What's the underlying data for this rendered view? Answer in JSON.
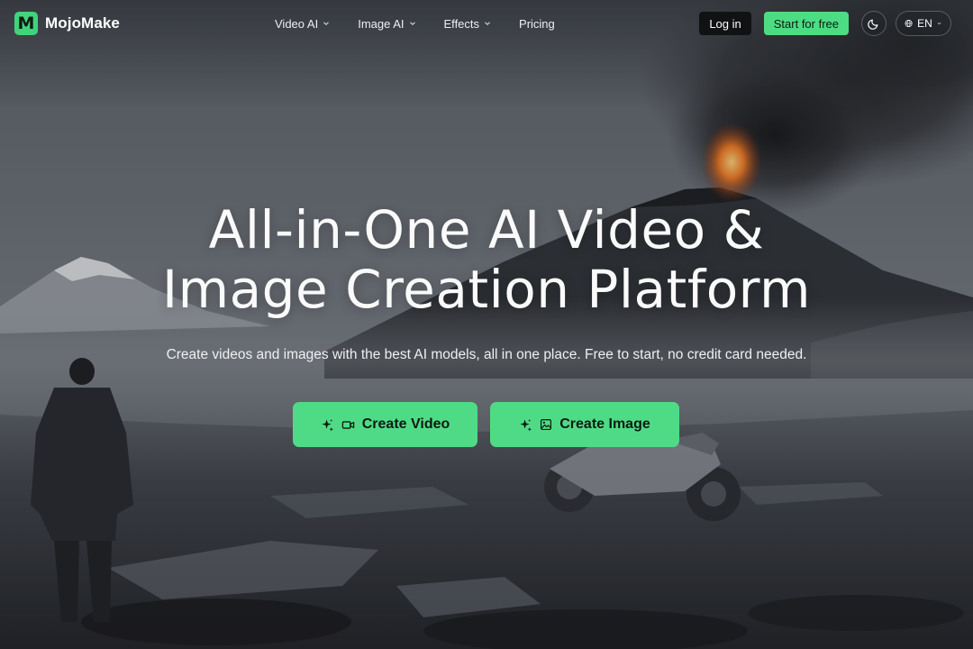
{
  "brand": {
    "mark": "M",
    "name": "MojoMake"
  },
  "nav": [
    {
      "label": "Video AI",
      "has_dropdown": true
    },
    {
      "label": "Image AI",
      "has_dropdown": true
    },
    {
      "label": "Effects",
      "has_dropdown": true
    },
    {
      "label": "Pricing",
      "has_dropdown": false
    }
  ],
  "actions": {
    "login_label": "Log in",
    "start_label": "Start for free",
    "theme_icon": "moon-icon",
    "language_label": "EN",
    "language_icon": "globe-icon"
  },
  "hero": {
    "title_line1": "All-in-One AI Video &",
    "title_line2": "Image Creation Platform",
    "subtitle": "Create videos and images with the best AI models, all in one place. Free to start, no credit card needed."
  },
  "cta": {
    "video_label": "Create Video",
    "video_icons": [
      "sparkle-icon",
      "video-camera-icon"
    ],
    "image_label": "Create Image",
    "image_icons": [
      "sparkle-icon",
      "image-icon"
    ]
  },
  "colors": {
    "accent": "#4fdb86",
    "login_bg": "#111214",
    "text": "#ffffff"
  }
}
